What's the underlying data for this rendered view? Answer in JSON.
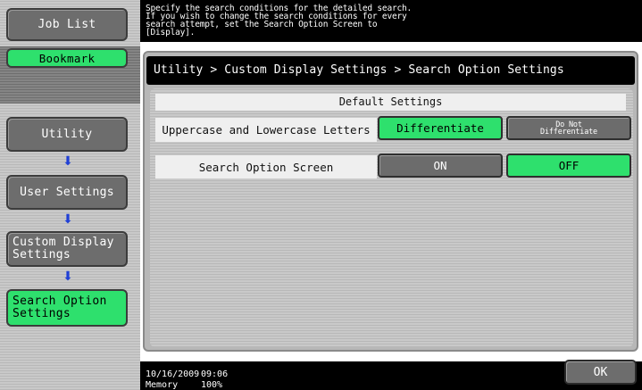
{
  "left_nav": {
    "job_list_label": "Job List",
    "bookmark_label": "Bookmark",
    "breadcrumb_steps": [
      {
        "label": "Utility"
      },
      {
        "label": "User Settings"
      },
      {
        "label": "Custom Display\nSettings"
      },
      {
        "label": "Search Option\nSettings"
      }
    ],
    "arrow_icon": "down-arrow-icon"
  },
  "message": {
    "text": "Specify the search conditions for the detailed search.\nIf you wish to change the search conditions for every\nsearch attempt, set the Search Option Screen to\n[Display]."
  },
  "header": {
    "breadcrumb": "Utility > Custom Display Settings > Search Option Settings"
  },
  "panel": {
    "section_title": "Default Settings",
    "rows": [
      {
        "label": "Uppercase and Lowercase Letters",
        "options": [
          {
            "label": "Differentiate",
            "selected": true
          },
          {
            "label": "Do Not\nDifferentiate",
            "selected": false
          }
        ]
      },
      {
        "label": "Search Option Screen",
        "options": [
          {
            "label": "ON",
            "selected": false
          },
          {
            "label": "OFF",
            "selected": true
          }
        ]
      }
    ]
  },
  "status": {
    "date": "10/16/2009",
    "time": "09:06",
    "memory_label": "Memory",
    "memory_value": "100%"
  },
  "footer": {
    "ok_label": "OK"
  },
  "colors": {
    "selected": "#2ee06d",
    "unselected": "#6c6c6c",
    "arrow": "#1f3fd6",
    "bar": "#000000"
  }
}
